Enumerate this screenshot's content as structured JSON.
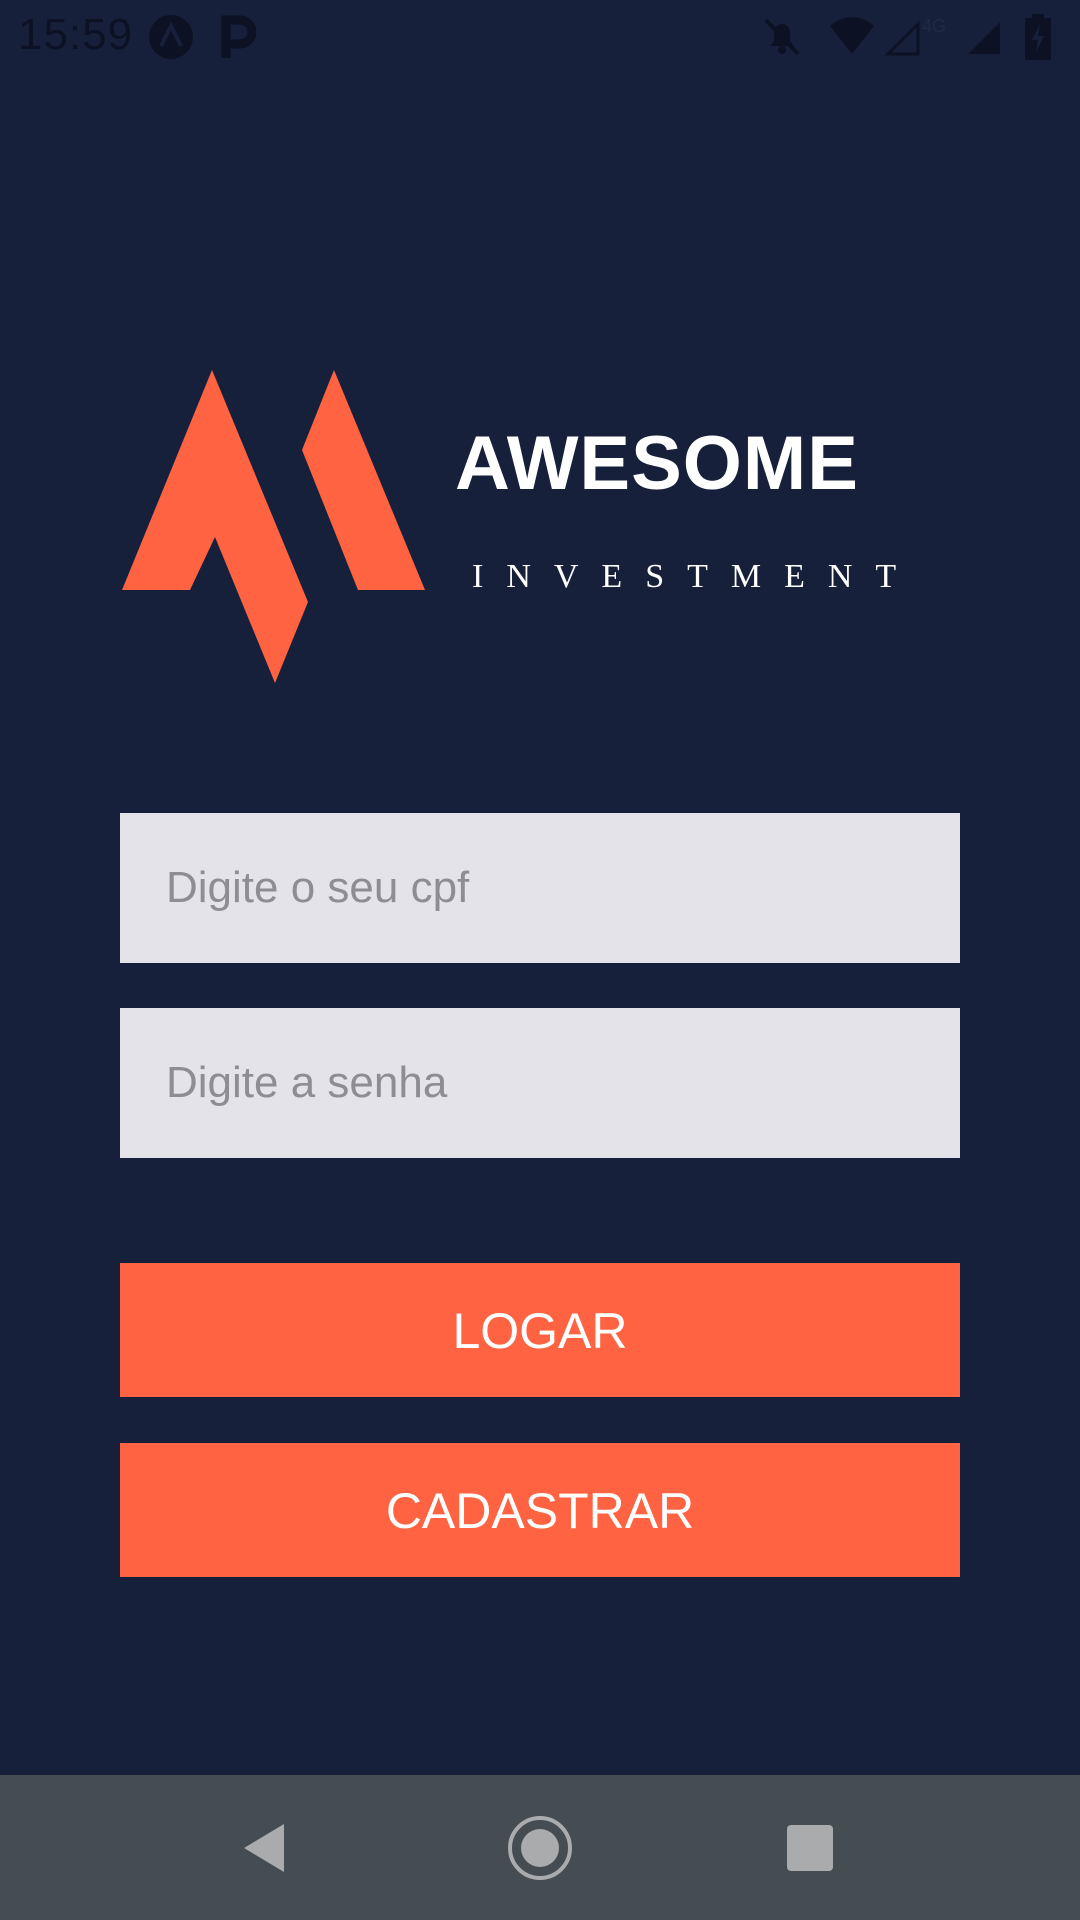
{
  "status_bar": {
    "time": "15:59",
    "network_label": "4G"
  },
  "brand": {
    "title": "AWESOME",
    "subtitle": "INVESTMENT",
    "accent_color": "#ff6342",
    "background_color": "#16203a"
  },
  "login_form": {
    "cpf_placeholder": "Digite o seu cpf",
    "cpf_value": "",
    "password_placeholder": "Digite a senha",
    "password_value": "",
    "login_label": "LOGAR",
    "register_label": "CADASTRAR"
  },
  "nav_bar": {
    "icons": [
      "back-icon",
      "home-icon",
      "recents-icon"
    ]
  }
}
